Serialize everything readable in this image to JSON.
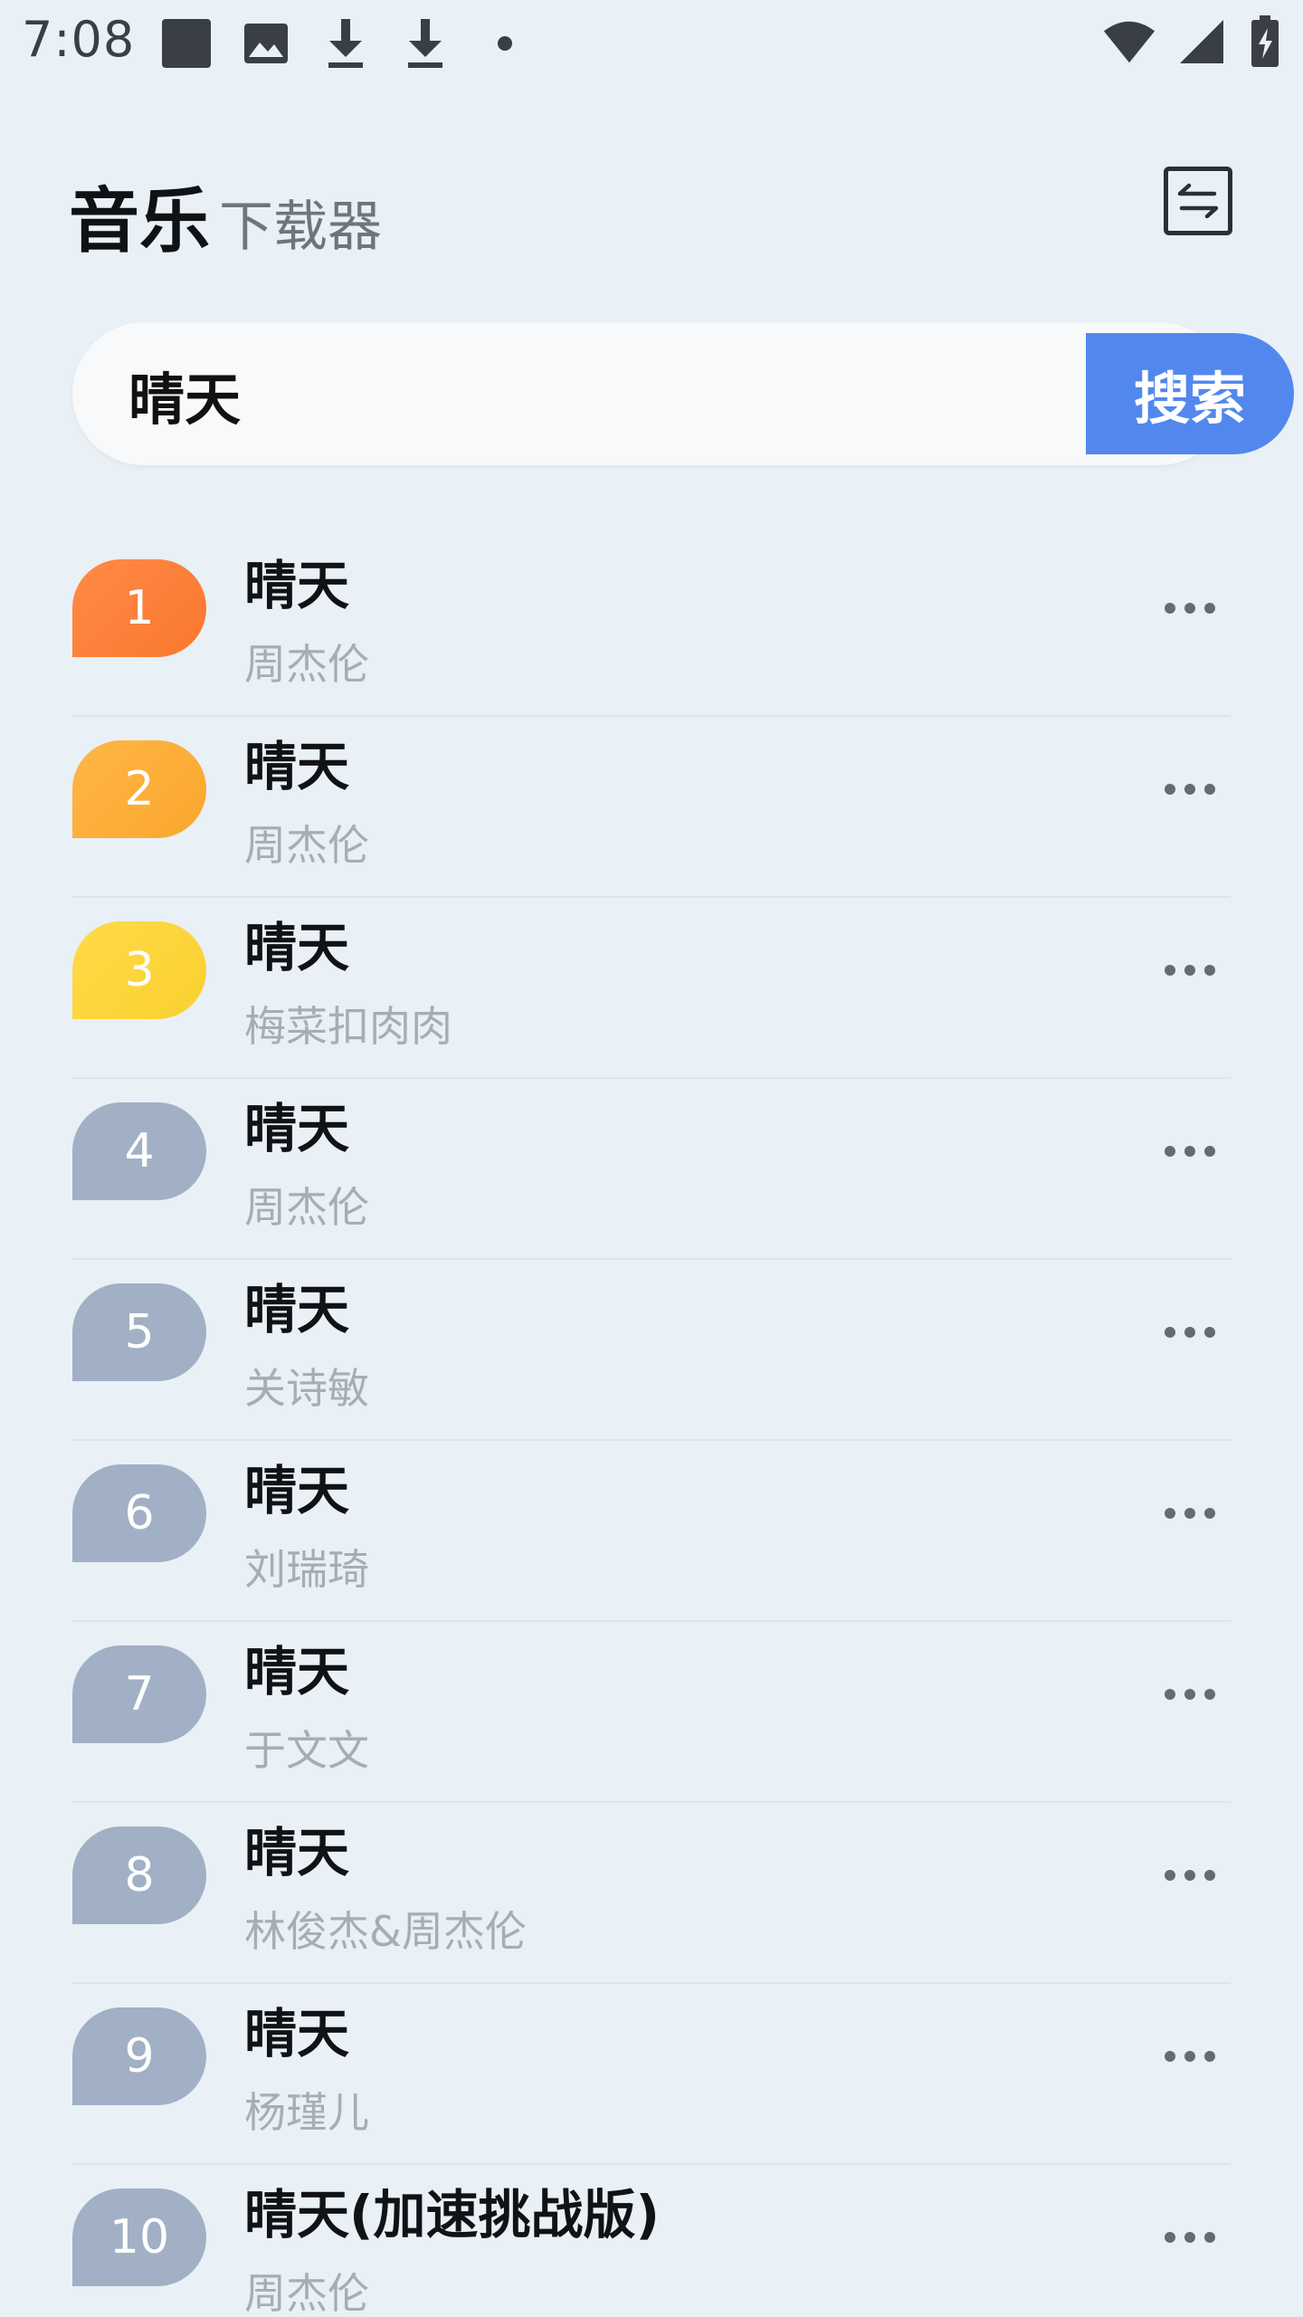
{
  "status_bar": {
    "time": "7:08",
    "left_icons": [
      "square-notification-icon",
      "image-icon",
      "download-icon",
      "download-icon",
      "dot-icon"
    ],
    "right_icons": [
      "wifi-icon",
      "signal-icon",
      "battery-charging-icon"
    ]
  },
  "header": {
    "title_main": "音乐",
    "title_sub": "下载器",
    "switch_icon": "swap-icon"
  },
  "search": {
    "value": "晴天",
    "button_label": "搜索"
  },
  "colors": {
    "accent": "#5288ee",
    "rank1": "#ff7a2e",
    "rank2": "#ffab2d",
    "rank3": "#ffd530",
    "rank_other": "#a1b0c5"
  },
  "songs": [
    {
      "rank": "1",
      "title": "晴天",
      "artist": "周杰伦"
    },
    {
      "rank": "2",
      "title": "晴天",
      "artist": "周杰伦"
    },
    {
      "rank": "3",
      "title": "晴天",
      "artist": "梅菜扣肉肉"
    },
    {
      "rank": "4",
      "title": "晴天",
      "artist": "周杰伦"
    },
    {
      "rank": "5",
      "title": "晴天",
      "artist": "关诗敏"
    },
    {
      "rank": "6",
      "title": "晴天",
      "artist": "刘瑞琦"
    },
    {
      "rank": "7",
      "title": "晴天",
      "artist": "于文文"
    },
    {
      "rank": "8",
      "title": "晴天",
      "artist": "林俊杰&周杰伦"
    },
    {
      "rank": "9",
      "title": "晴天",
      "artist": "杨瑾儿"
    },
    {
      "rank": "10",
      "title": "晴天(加速挑战版)",
      "artist": "周杰伦"
    }
  ]
}
